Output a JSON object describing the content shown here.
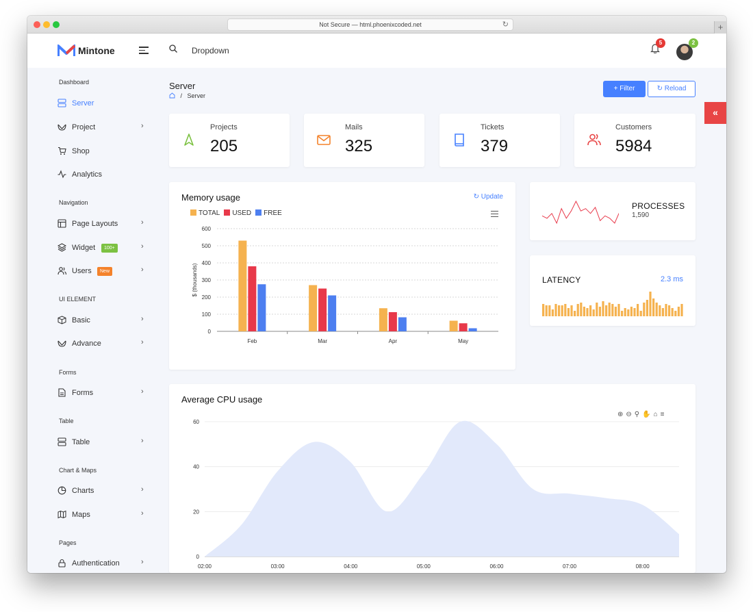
{
  "browser": {
    "url": "Not Secure — html.phoenixcoded.net",
    "new_tab_label": "+"
  },
  "topbar": {
    "brand": "Mintone",
    "dropdown_label": "Dropdown",
    "notification_count": "5",
    "avatar_badge": "2"
  },
  "sidebar": {
    "sections": [
      {
        "title": "Dashboard"
      },
      {
        "title": "Navigation"
      },
      {
        "title": "UI ELEMENT"
      },
      {
        "title": "Forms"
      },
      {
        "title": "Table"
      },
      {
        "title": "Chart & Maps"
      },
      {
        "title": "Pages"
      }
    ],
    "items": [
      {
        "label": "Server",
        "icon": "server-icon",
        "active": true
      },
      {
        "label": "Project",
        "icon": "project-icon"
      },
      {
        "label": "Shop",
        "icon": "cart-icon"
      },
      {
        "label": "Analytics",
        "icon": "activity-icon"
      },
      {
        "label": "Page Layouts",
        "icon": "layout-icon"
      },
      {
        "label": "Widget",
        "icon": "layers-icon",
        "badge": "100+"
      },
      {
        "label": "Users",
        "icon": "users-icon",
        "badge": "New"
      },
      {
        "label": "Basic",
        "icon": "box-icon"
      },
      {
        "label": "Advance",
        "icon": "gift-icon"
      },
      {
        "label": "Forms",
        "icon": "file-text-icon"
      },
      {
        "label": "Table",
        "icon": "server-icon"
      },
      {
        "label": "Charts",
        "icon": "pie-chart-icon"
      },
      {
        "label": "Maps",
        "icon": "map-icon"
      },
      {
        "label": "Authentication",
        "icon": "lock-icon"
      }
    ],
    "badge_colors": {
      "widget": "#7cc142",
      "users": "#f4822b"
    }
  },
  "page": {
    "title": "Server",
    "breadcrumb_current": "Server",
    "breadcrumb_sep": "/",
    "filter_label": "Filter",
    "reload_label": "Reload",
    "collapse_label": "«"
  },
  "stats": [
    {
      "label": "Projects",
      "value": "205",
      "icon": "navigation-icon",
      "color": "#7cc142"
    },
    {
      "label": "Mails",
      "value": "325",
      "icon": "mail-icon",
      "color": "#f4822b"
    },
    {
      "label": "Tickets",
      "value": "379",
      "icon": "book-icon",
      "color": "#4680ff"
    },
    {
      "label": "Customers",
      "value": "5984",
      "icon": "users-icon",
      "color": "#e84545"
    }
  ],
  "memory": {
    "title": "Memory usage",
    "update_label": "Update"
  },
  "processes": {
    "title": "PROCESSES",
    "value": "1,590"
  },
  "latency": {
    "title": "LATENCY",
    "value": "2.3 ms"
  },
  "cpu": {
    "title": "Average CPU usage"
  },
  "colors": {
    "accent": "#4680ff",
    "total": "#f5b24f",
    "used": "#e8394a",
    "free": "#4d7ff0",
    "area": "#e2e9fb",
    "sparkline": "#e8394a",
    "latency_bars": "#f5b24f"
  },
  "chart_data": [
    {
      "type": "bar",
      "title": "Memory usage",
      "categories": [
        "Feb",
        "Mar",
        "Apr",
        "May"
      ],
      "series": [
        {
          "name": "TOTAL",
          "values": [
            530,
            270,
            135,
            62
          ]
        },
        {
          "name": "USED",
          "values": [
            380,
            250,
            112,
            47
          ]
        },
        {
          "name": "FREE",
          "values": [
            275,
            210,
            82,
            18
          ]
        }
      ],
      "ylabel": "$ (thousands)",
      "ylim": [
        0,
        600
      ],
      "yticks": [
        0,
        100,
        200,
        300,
        400,
        500,
        600
      ],
      "legend": "top-left",
      "grid": true
    },
    {
      "type": "line",
      "title": "PROCESSES",
      "values": [
        24,
        22,
        26,
        18,
        30,
        22,
        28,
        36,
        28,
        30,
        26,
        31,
        20,
        24,
        22,
        18,
        27,
        25
      ]
    },
    {
      "type": "bar",
      "title": "LATENCY",
      "values": [
        9,
        8,
        8,
        5,
        9,
        8,
        8,
        9,
        6,
        8,
        4,
        9,
        10,
        7,
        6,
        8,
        5,
        10,
        7,
        11,
        8,
        10,
        9,
        7,
        9,
        4,
        6,
        5,
        7,
        6,
        9,
        4,
        10,
        12,
        18,
        13,
        10,
        8,
        6,
        9,
        8,
        6,
        4,
        7,
        9
      ]
    },
    {
      "type": "area",
      "title": "Average CPU usage",
      "x": [
        "02:00",
        "02:30",
        "03:00",
        "03:30",
        "04:00",
        "04:30",
        "05:00",
        "05:30",
        "06:00",
        "06:30",
        "07:00",
        "07:30",
        "08:00",
        "08:30"
      ],
      "values": [
        0,
        14,
        38,
        51,
        42,
        20,
        37,
        60,
        50,
        30,
        28,
        26,
        23,
        10
      ],
      "xticks": [
        "02:00",
        "03:00",
        "04:00",
        "05:00",
        "06:00",
        "07:00",
        "08:00"
      ],
      "ylim": [
        0,
        60
      ],
      "yticks": [
        0,
        20,
        40,
        60
      ],
      "grid": true
    }
  ]
}
